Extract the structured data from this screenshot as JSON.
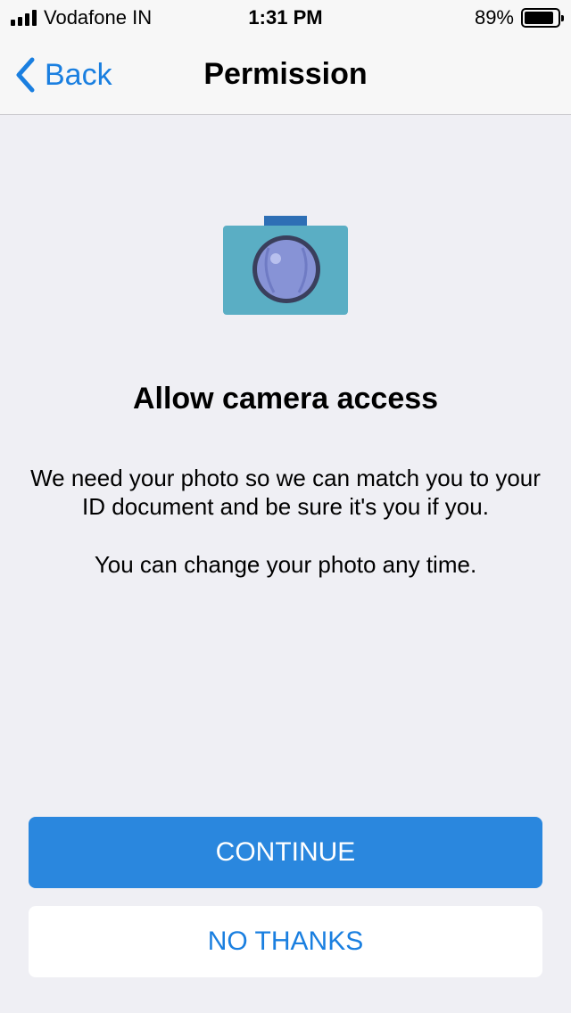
{
  "status_bar": {
    "carrier": "Vodafone IN",
    "time": "1:31 PM",
    "battery_percent": "89%",
    "battery_level": 0.89
  },
  "nav": {
    "back_label": "Back",
    "title": "Permission"
  },
  "content": {
    "icon": "camera-icon",
    "headline": "Allow camera access",
    "body_line1": "We need your photo so we can match you to your ID document and be sure it's you if you.",
    "body_line2": "You can change your photo any time."
  },
  "actions": {
    "continue_label": "CONTINUE",
    "no_thanks_label": "NO THANKS"
  },
  "colors": {
    "accent": "#2a87de",
    "link": "#1a7fe0",
    "camera_body": "#5aaec4",
    "camera_lens": "#8793d6"
  }
}
